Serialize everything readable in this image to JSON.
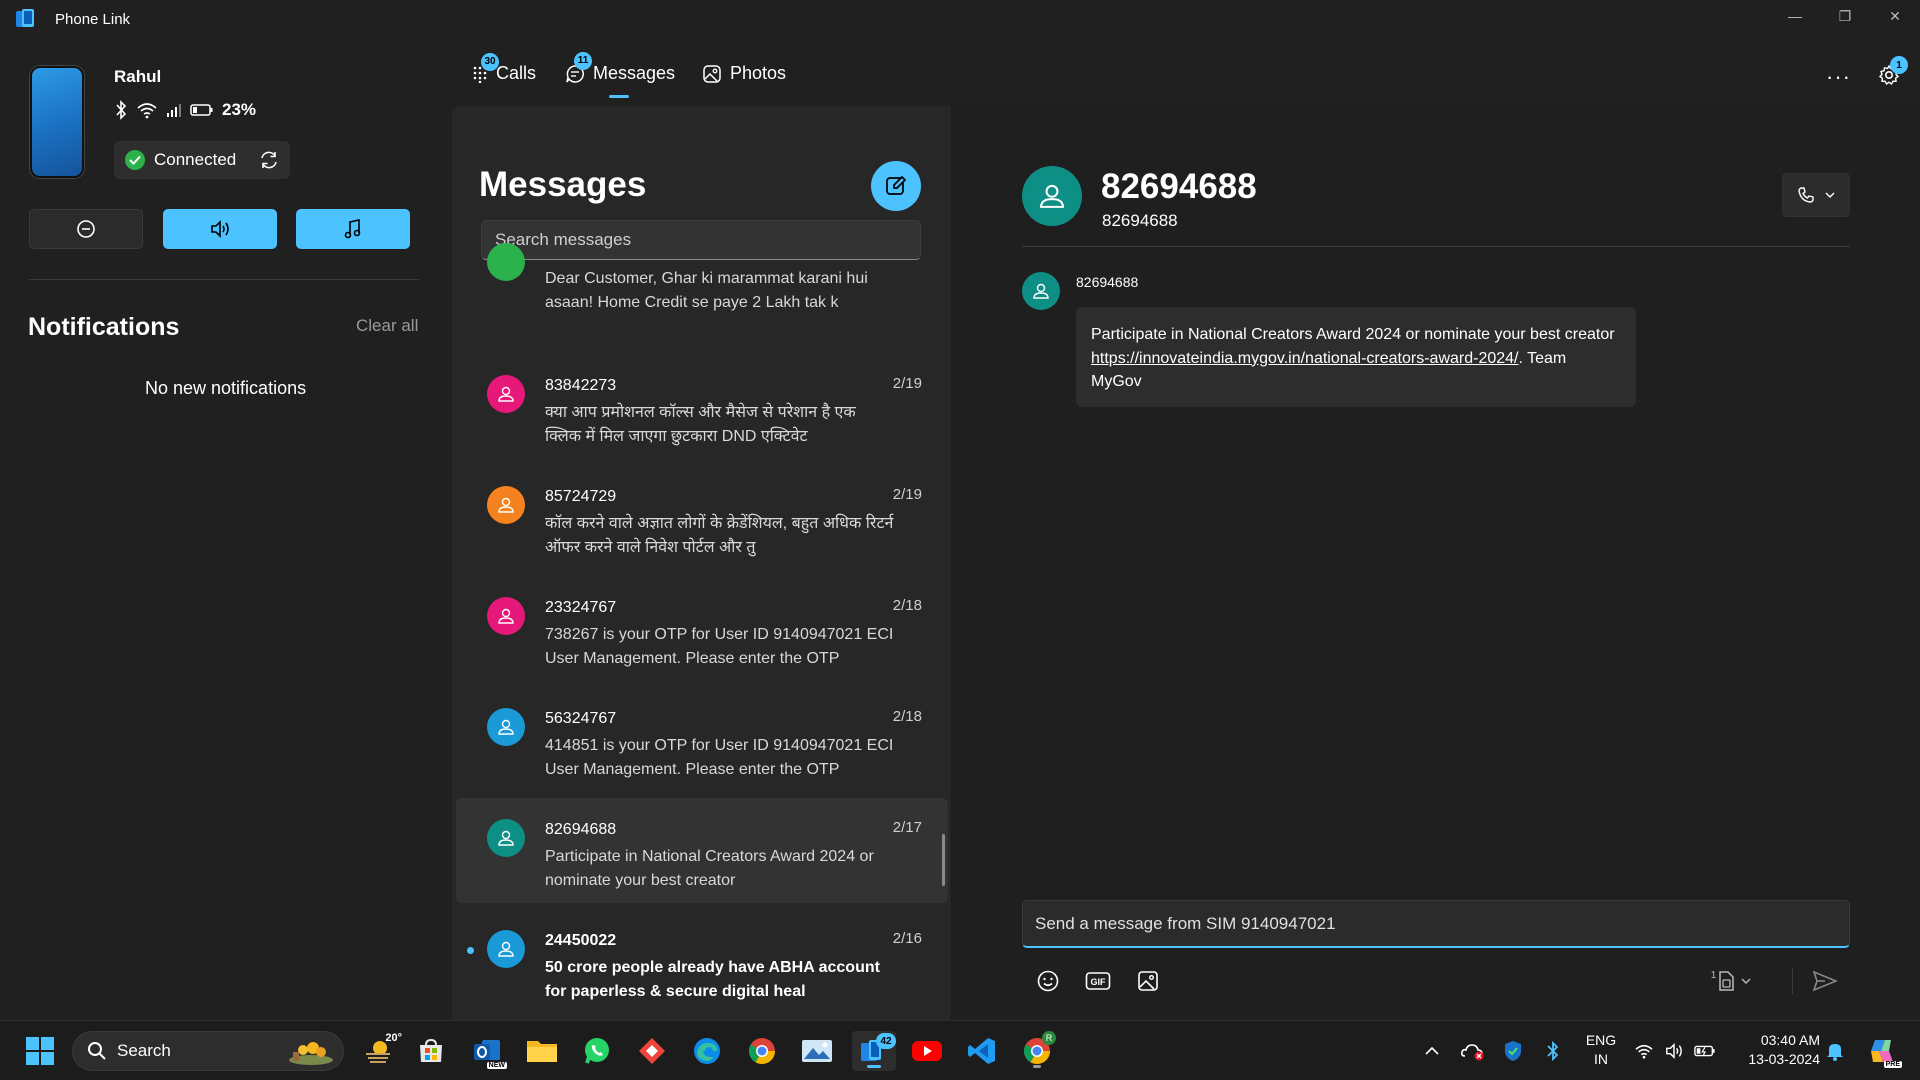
{
  "window": {
    "title": "Phone Link",
    "minimize": "—",
    "restore": "❐",
    "close": "✕"
  },
  "device": {
    "name": "Rahul",
    "battery": "23%",
    "connection_status": "Connected"
  },
  "notifications": {
    "title": "Notifications",
    "clear_all": "Clear all",
    "empty_text": "No new notifications"
  },
  "tabs": [
    {
      "label": "Calls",
      "badge": "30",
      "icon": "dialpad-icon"
    },
    {
      "label": "Messages",
      "badge": "11",
      "icon": "chat-icon",
      "active": true
    },
    {
      "label": "Photos",
      "badge": "",
      "icon": "photos-icon"
    }
  ],
  "settings_badge": "1",
  "more_label": "···",
  "messages_list": {
    "title": "Messages",
    "search_placeholder": "Search messages",
    "conversations": [
      {
        "name": "",
        "date": "",
        "preview": "Dear Customer, Ghar ki marammat karani hui asaan! Home Credit se paye 2 Lakh tak k",
        "avatar_color": "#2bb24c",
        "unread": false
      },
      {
        "name": "83842273",
        "date": "2/19",
        "preview": "क्या आप प्रमोशनल कॉल्स और मैसेज से परेशान है एक क्लिक में मिल जाएगा छुटकारा DND एक्टिवेट",
        "avatar_color": "#e6197a",
        "unread": false
      },
      {
        "name": "85724729",
        "date": "2/19",
        "preview": "कॉल करने वाले अज्ञात लोगों के क्रेडेंशियल, बहुत अधिक रिटर्न ऑफर करने वाले निवेश पोर्टल और तु",
        "avatar_color": "#f5821f",
        "unread": false
      },
      {
        "name": "23324767",
        "date": "2/18",
        "preview": "738267 is your OTP for User ID 9140947021 ECI User Management. Please enter the OTP",
        "avatar_color": "#e6197a",
        "unread": false
      },
      {
        "name": "56324767",
        "date": "2/18",
        "preview": "414851 is your OTP for User ID 9140947021 ECI User Management. Please enter the OTP",
        "avatar_color": "#1a9ad6",
        "unread": false
      },
      {
        "name": "82694688",
        "date": "2/17",
        "preview": "Participate in National Creators Award 2024 or nominate your best creator",
        "avatar_color": "#0e8f86",
        "unread": false,
        "selected": true
      },
      {
        "name": "24450022",
        "date": "2/16",
        "preview": "50 crore people already have ABHA account for paperless & secure digital heal",
        "avatar_color": "#1a9ad6",
        "unread": true
      }
    ]
  },
  "conversation": {
    "title": "82694688",
    "subtitle": "82694688",
    "sender": "82694688",
    "message_text_1": "Participate in National Creators Award 2024 or nominate your best creator ",
    "message_link": "https://innovateindia.mygov.in/national-creators-award-2024/",
    "message_text_2": ". Team MyGov",
    "compose_placeholder": "Send a message from SIM 9140947021",
    "sim_label": "1"
  },
  "taskbar": {
    "search_label": "Search",
    "weather": "20°",
    "outlook_tag": "NEW",
    "phonelink_badge": "42",
    "lang_top": "ENG",
    "lang_bottom": "IN",
    "time": "03:40 AM",
    "date": "13-03-2024",
    "chrome_profile": "R",
    "copilot_tag": "PRE"
  },
  "colors": {
    "accent": "#4cc2ff",
    "background": "#202020",
    "panel": "#272727",
    "chat_bg": "#1f1f1f"
  }
}
